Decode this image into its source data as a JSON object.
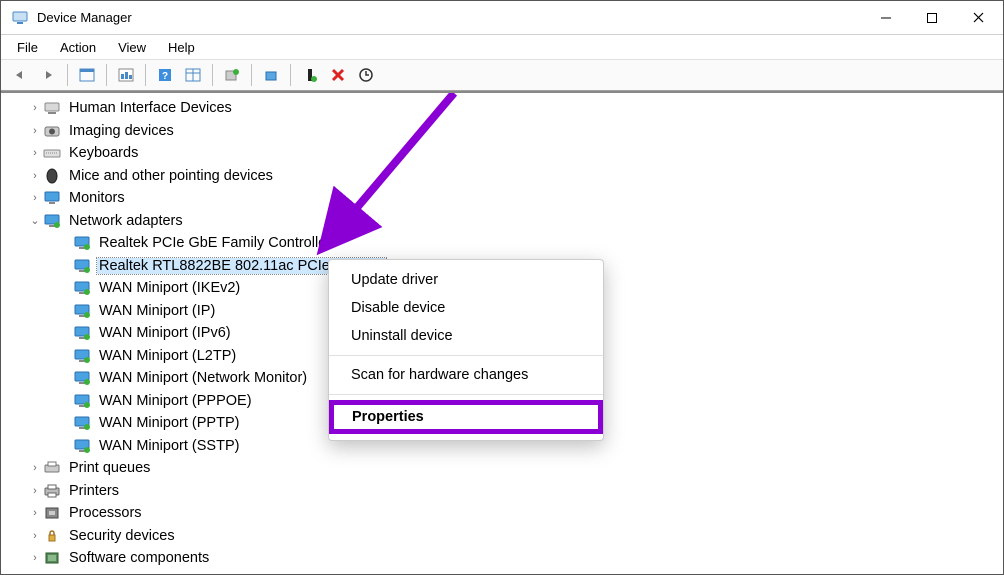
{
  "window": {
    "title": "Device Manager"
  },
  "menu": {
    "file": "File",
    "action": "Action",
    "view": "View",
    "help": "Help"
  },
  "tree": {
    "categories": [
      {
        "icon": "hid",
        "label": "Human Interface Devices",
        "expanded": false
      },
      {
        "icon": "imaging",
        "label": "Imaging devices",
        "expanded": false
      },
      {
        "icon": "keyboard",
        "label": "Keyboards",
        "expanded": false
      },
      {
        "icon": "mouse",
        "label": "Mice and other pointing devices",
        "expanded": false
      },
      {
        "icon": "monitor",
        "label": "Monitors",
        "expanded": false
      },
      {
        "icon": "network",
        "label": "Network adapters",
        "expanded": true
      },
      {
        "icon": "printqueue",
        "label": "Print queues",
        "expanded": false
      },
      {
        "icon": "printer",
        "label": "Printers",
        "expanded": false
      },
      {
        "icon": "cpu",
        "label": "Processors",
        "expanded": false
      },
      {
        "icon": "security",
        "label": "Security devices",
        "expanded": false
      },
      {
        "icon": "software",
        "label": "Software components",
        "expanded": false
      }
    ],
    "network_children": [
      {
        "label": "Realtek PCIe GbE Family Controller",
        "selected": false
      },
      {
        "label": "Realtek RTL8822BE 802.11ac PCIe Adapter",
        "selected": true
      },
      {
        "label": "WAN Miniport (IKEv2)",
        "selected": false
      },
      {
        "label": "WAN Miniport (IP)",
        "selected": false
      },
      {
        "label": "WAN Miniport (IPv6)",
        "selected": false
      },
      {
        "label": "WAN Miniport (L2TP)",
        "selected": false
      },
      {
        "label": "WAN Miniport (Network Monitor)",
        "selected": false
      },
      {
        "label": "WAN Miniport (PPPOE)",
        "selected": false
      },
      {
        "label": "WAN Miniport (PPTP)",
        "selected": false
      },
      {
        "label": "WAN Miniport (SSTP)",
        "selected": false
      }
    ]
  },
  "context_menu": {
    "update": "Update driver",
    "disable": "Disable device",
    "uninstall": "Uninstall device",
    "scan": "Scan for hardware changes",
    "properties": "Properties"
  },
  "annotation": {
    "arrow_color": "#8a00d4"
  }
}
